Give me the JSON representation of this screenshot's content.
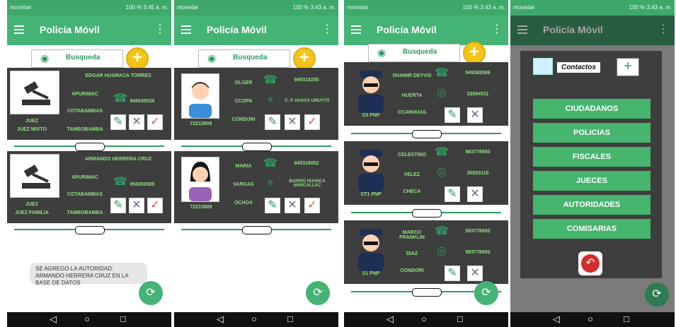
{
  "common": {
    "app_title": "Policía Móvil",
    "search_label": "Busqueda",
    "status_left": "movistar",
    "status_right": [
      "100 % 3:45 a. m.",
      "100 % 3:43 a. m.",
      "100 % 3:43 a. m.",
      "100 % 3:43 a. m."
    ]
  },
  "screen1": {
    "cards": [
      {
        "name": "EDGAR HUARACA TORRES",
        "line1": "APURIMAC",
        "line2": "COTABAMBAS",
        "line3": "TAMBOBAMBA",
        "phone": "946638526",
        "role1": "JUEZ",
        "role2": "JUEZ MIXTO"
      },
      {
        "name": "ARMANDO HERRERA CRUZ",
        "line1": "APURIMAC",
        "line2": "COTABAMBAS",
        "line3": "TAMBOBAMBA",
        "phone": "956858585",
        "role1": "JUEZ",
        "role2": "JUEZ FAMILIA"
      }
    ],
    "toast": "SE AGREGO LA AUTORIDAD: ARMANDO HERRERA CRUZ EN LA BASE DE DATOS"
  },
  "screen2": {
    "cards": [
      {
        "first": "OLGER",
        "second": "CCOPA",
        "third": "CONDORI",
        "id": "72212608",
        "phone": "945318255",
        "address": "C. P. HUACA UMUYTO"
      },
      {
        "first": "MARIA",
        "second": "VARGAS",
        "third": "OCHOA",
        "id": "72215689",
        "phone": "945318052",
        "address": "BARRIO HUANCA MARCALLAC"
      }
    ]
  },
  "screen3": {
    "cards": [
      {
        "name": "SHAMIR DEYVIS",
        "middle": "HUERTA",
        "last": "CCARHUAS",
        "phone": "949382869",
        "doc": "32094511",
        "rank": "S3 PNP"
      },
      {
        "name": "CELESTINO",
        "middle": "VELEZ",
        "last": "CHECA",
        "phone": "983778693",
        "doc": "30920116",
        "rank": "ST1 PNP"
      },
      {
        "name": "MARCO FRANKLIN",
        "middle": "DIAZ",
        "last": "CONDORI",
        "phone": "983778693",
        "doc": "983778693",
        "rank": "S1 PNP"
      }
    ]
  },
  "screen4": {
    "dialog_title": "Contactos",
    "options": [
      "CIUDADANOS",
      "POLICIAS",
      "FISCALES",
      "JUECES",
      "AUTORIDADES",
      "COMISARIAS"
    ]
  }
}
